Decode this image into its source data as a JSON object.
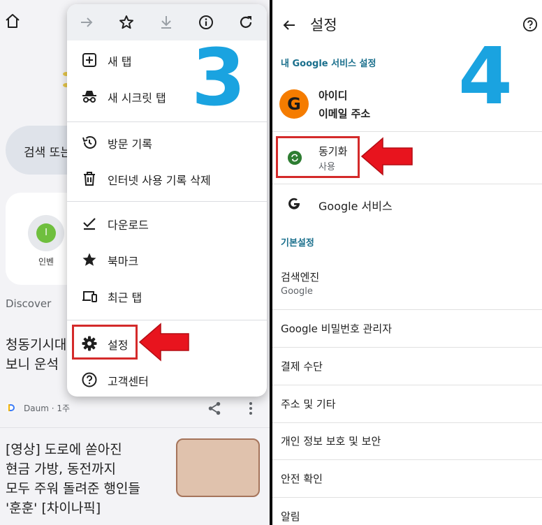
{
  "left": {
    "search_text": "검색 또는",
    "shortcut": {
      "label": "인벤",
      "icon_letter": "I"
    },
    "discover_label": "Discover",
    "article1": {
      "line1": "청동기시대",
      "line2": "보니 운석"
    },
    "source": {
      "name": "Daum",
      "age": "1주"
    },
    "article2": {
      "line1": "[영상] 도로에 쏟아진",
      "line2": "현금 가방, 동전까지",
      "line3": "모두 주워 돌려준 행인들",
      "line4": "'훈훈' [차이나픽]"
    },
    "menu": {
      "items": [
        {
          "label": "새 탭",
          "icon": "add-box-icon"
        },
        {
          "label": "새 시크릿 탭",
          "icon": "incognito-icon"
        },
        {
          "label": "방문 기록",
          "icon": "history-icon"
        },
        {
          "label": "인터넷 사용 기록 삭제",
          "icon": "trash-icon"
        },
        {
          "label": "다운로드",
          "icon": "download-done-icon"
        },
        {
          "label": "북마크",
          "icon": "star-filled-icon"
        },
        {
          "label": "최근 탭",
          "icon": "devices-icon"
        },
        {
          "label": "설정",
          "icon": "gear-icon"
        },
        {
          "label": "고객센터",
          "icon": "help-circle-icon"
        }
      ]
    },
    "step_number": "3"
  },
  "right": {
    "title": "설정",
    "section_google": "내 Google 서비스 설정",
    "account": {
      "avatar_letter": "G",
      "name": "아이디",
      "email": "이메일 주소"
    },
    "sync": {
      "title": "동기화",
      "status": "사용"
    },
    "google_services": "Google 서비스",
    "section_basic": "기본설정",
    "search_engine": {
      "title": "검색엔진",
      "value": "Google"
    },
    "items": [
      "Google 비밀번호 관리자",
      "결제 수단",
      "주소 및 기타",
      "개인 정보 보호 및 보안",
      "안전 확인",
      "알림"
    ],
    "step_number": "4"
  },
  "colors": {
    "accent_blue": "#1aa3e0",
    "highlight_red": "#d42a2a",
    "arrow_red": "#e8141e",
    "section_teal": "#1a6f8c"
  }
}
